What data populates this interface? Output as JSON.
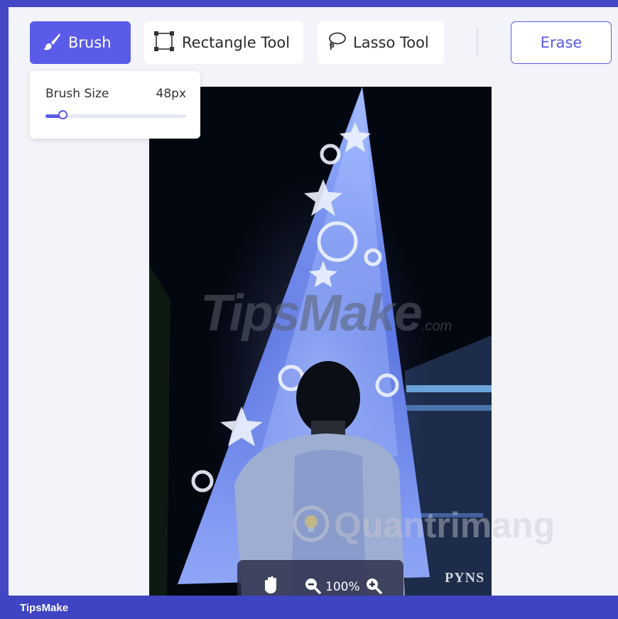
{
  "toolbar": {
    "brush_label": "Brush",
    "rectangle_label": "Rectangle Tool",
    "lasso_label": "Lasso Tool",
    "erase_label": "Erase",
    "active_tool": "brush"
  },
  "brush_panel": {
    "label": "Brush Size",
    "value": "48px",
    "slider_fraction": 0.09
  },
  "zoom": {
    "level": "100%",
    "icons": [
      "hand-icon",
      "zoom-out-icon",
      "zoom-in-icon"
    ]
  },
  "watermarks": {
    "tipsmake": "TipsMake",
    "tipsmake_suffix": ".com",
    "quantrimang": "Quantrimang",
    "signature": "PYNS"
  },
  "footer": {
    "brand": "TipsMake"
  },
  "colors": {
    "accent": "#5a5be8",
    "frame_border": "#4347c4",
    "canvas_bg": "#f3f4f9"
  }
}
